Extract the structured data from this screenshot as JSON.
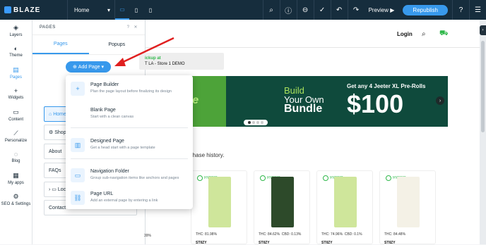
{
  "topbar": {
    "logo": "BLAZE",
    "page_select": "Home",
    "preview": "Preview",
    "republish": "Republish"
  },
  "leftnav": {
    "items": [
      {
        "label": "Layers",
        "icon": "layers-icon"
      },
      {
        "label": "Theme",
        "icon": "palette-icon"
      },
      {
        "label": "Pages",
        "icon": "pages-icon"
      },
      {
        "label": "Widgets",
        "icon": "plus-icon"
      },
      {
        "label": "Content",
        "icon": "folder-icon"
      },
      {
        "label": "Personalize",
        "icon": "personalize-icon"
      },
      {
        "label": "Blog",
        "icon": "blog-icon"
      },
      {
        "label": "My apps",
        "icon": "apps-icon"
      },
      {
        "label": "SEO & Settings",
        "icon": "gear-icon"
      }
    ]
  },
  "panel": {
    "title": "PAGES",
    "tabs": [
      "Pages",
      "Popups"
    ],
    "add_page": "Add Page",
    "pages": [
      "Home",
      "Shop",
      "About",
      "FAQs",
      "Loc",
      "Contact"
    ]
  },
  "dropdown": {
    "items": [
      {
        "title": "Page Builder",
        "desc": "Plan the page layout before finalizing its design"
      },
      {
        "title": "Blank Page",
        "desc": "Start with a clean canvas"
      },
      {
        "title": "Designed Page",
        "desc": "Get a head start with a page template"
      },
      {
        "title": "Navigation Folder",
        "desc": "Group sub-navigation items like anchors and pages"
      },
      {
        "title": "Page URL",
        "desc": "Add an external page by entering a link"
      }
    ]
  },
  "site": {
    "login": "Login",
    "pickup_line1": "ickup at",
    "pickup_line2": "T LA - Store 1 DEMO",
    "banner_green_text": "dle",
    "banner_build": "Build",
    "banner_your_own": "Your Own",
    "banner_bundle": "Bundle",
    "banner_offer": "Get any 4 Jeeter XL Pre-Rolls",
    "banner_price": "$100",
    "heading_fragment": "s",
    "purchase_text": "rchase history.",
    "left_fragment": "39%",
    "cards": [
      {
        "badge": "HYBRID",
        "thc": "THC: 81.98%",
        "cbd": "",
        "brand": "STIIZY"
      },
      {
        "badge": "HYBRID",
        "thc": "THC: 84.62%",
        "cbd": "CBD: 0.13%",
        "brand": "STIIZY"
      },
      {
        "badge": "HYBRID",
        "thc": "THC: 74.96%",
        "cbd": "CBD: 0.1%",
        "brand": "STIIZY"
      },
      {
        "badge": "HYBRID",
        "thc": "THC: 84.48%",
        "cbd": "",
        "brand": "STIIZY"
      }
    ]
  }
}
